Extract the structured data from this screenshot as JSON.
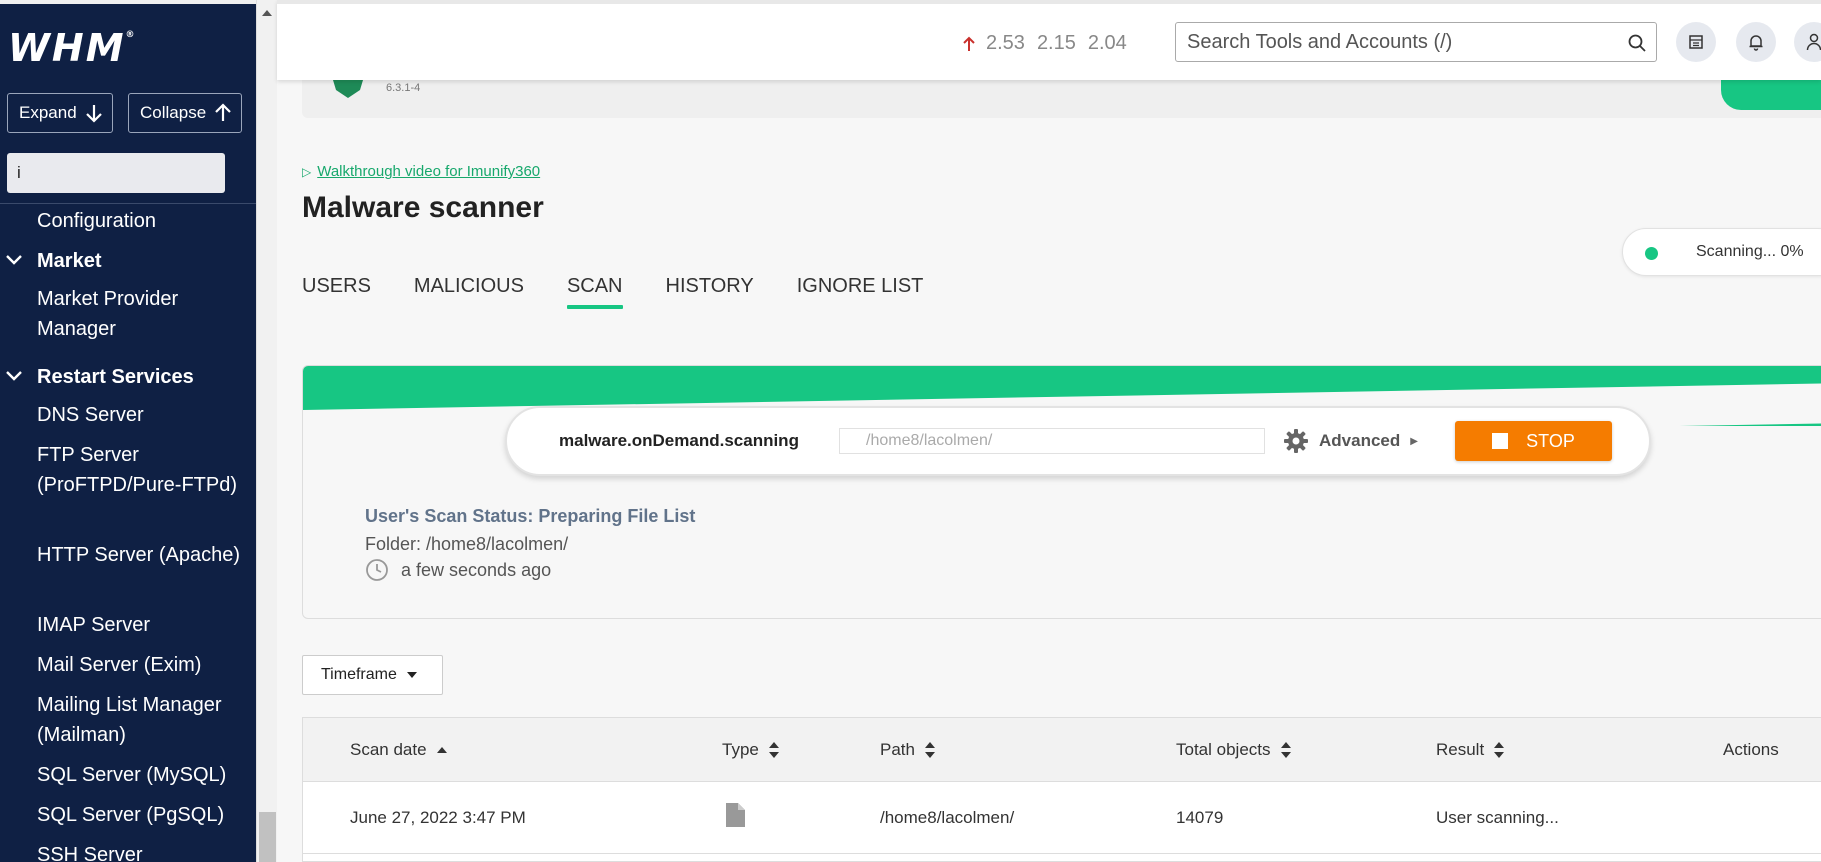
{
  "sidebar": {
    "logo": "WHM",
    "expand_label": "Expand",
    "collapse_label": "Collapse",
    "search_value": "i",
    "items": [
      {
        "type": "item",
        "label": "Configuration"
      },
      {
        "type": "category",
        "label": "Market"
      },
      {
        "type": "item",
        "label": "Market Provider Manager"
      },
      {
        "type": "category",
        "label": "Restart Services"
      },
      {
        "type": "item",
        "label": "DNS Server"
      },
      {
        "type": "item",
        "label": "FTP Server (ProFTPD/Pure-FTPd)"
      },
      {
        "type": "item",
        "label": "HTTP Server (Apache)"
      },
      {
        "type": "item",
        "label": "IMAP Server"
      },
      {
        "type": "item",
        "label": "Mail Server (Exim)"
      },
      {
        "type": "item",
        "label": "Mailing List Manager (Mailman)"
      },
      {
        "type": "item",
        "label": "SQL Server (MySQL)"
      },
      {
        "type": "item",
        "label": "SQL Server (PgSQL)"
      },
      {
        "type": "item",
        "label": "SSH Server"
      }
    ]
  },
  "header": {
    "load": [
      "2.53",
      "2.15",
      "2.04"
    ],
    "search_placeholder": "Search Tools and Accounts (/)",
    "icons": [
      "search-icon",
      "server-icon",
      "bell-icon",
      "user-icon"
    ]
  },
  "plugin": {
    "version": "6.3.1-4"
  },
  "main": {
    "walkthrough_link": "Walkthrough video for Imunify360",
    "title": "Malware scanner",
    "scan_status_pill": "Scanning... 0%",
    "tabs": [
      {
        "label": "USERS",
        "active": false
      },
      {
        "label": "MALICIOUS",
        "active": false
      },
      {
        "label": "SCAN",
        "active": true
      },
      {
        "label": "HISTORY",
        "active": false
      },
      {
        "label": "IGNORE LIST",
        "active": false
      }
    ]
  },
  "scan": {
    "label": "malware.onDemand.scanning",
    "path_value": "/home8/lacolmen/",
    "advanced_label": "Advanced",
    "stop_label": "STOP",
    "status_text": "User's Scan Status: Preparing File List",
    "folder_text": "Folder: /home8/lacolmen/",
    "time_text": "a few seconds ago"
  },
  "filters": {
    "timeframe_label": "Timeframe"
  },
  "table": {
    "headers": [
      "Scan date",
      "Type",
      "Path",
      "Total objects",
      "Result",
      "Actions"
    ],
    "rows": [
      {
        "scan_date": "June 27, 2022 3:47 PM",
        "type_icon": "file-icon",
        "path": "/home8/lacolmen/",
        "total_objects": "14079",
        "result": "User scanning..."
      }
    ]
  },
  "colors": {
    "sidebar_bg": "#0f2044",
    "accent_green": "#17c683",
    "stop_orange": "#f57c00",
    "load_arrow_red": "#c9302c"
  }
}
